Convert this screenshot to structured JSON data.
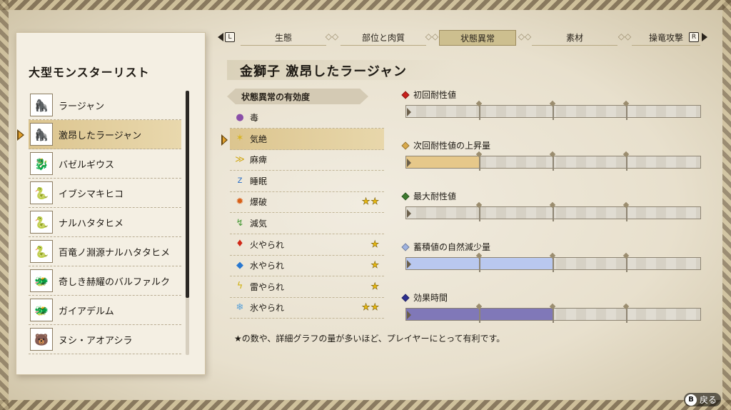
{
  "list_panel": {
    "title": "大型モンスターリスト",
    "items": [
      {
        "label": "ラージャン",
        "icon": "ape-monster-icon",
        "selected": false
      },
      {
        "label": "激昂したラージャン",
        "icon": "ape-monster-icon",
        "selected": true
      },
      {
        "label": "バゼルギウス",
        "icon": "wyvern-monster-icon",
        "selected": false
      },
      {
        "label": "イブシマキヒコ",
        "icon": "serpent-monster-icon",
        "selected": false
      },
      {
        "label": "ナルハタタヒメ",
        "icon": "serpent-monster-icon",
        "selected": false
      },
      {
        "label": "百竜ノ淵源ナルハタタヒメ",
        "icon": "serpent-monster-icon",
        "selected": false
      },
      {
        "label": "奇しき赫耀のバルファルク",
        "icon": "elder-dragon-icon",
        "selected": false
      },
      {
        "label": "ガイアデルム",
        "icon": "elder-dragon-icon",
        "selected": false
      },
      {
        "label": "ヌシ・アオアシラ",
        "icon": "bear-monster-icon",
        "selected": false
      }
    ]
  },
  "tabs": {
    "left_key": "L",
    "right_key": "R",
    "items": [
      {
        "label": "生態",
        "active": false
      },
      {
        "label": "部位と肉質",
        "active": false
      },
      {
        "label": "状態異常",
        "active": true
      },
      {
        "label": "素材",
        "active": false
      },
      {
        "label": "操竜攻撃",
        "active": false
      }
    ]
  },
  "monster_title": "金獅子 激昂したラージャン",
  "status_section": {
    "header": "状態異常の有効度",
    "rows": [
      {
        "label": "毒",
        "icon": "poison-icon",
        "stars": "",
        "star_count": 0,
        "selected": false
      },
      {
        "label": "気絶",
        "icon": "stun-icon",
        "stars": "",
        "star_count": 0,
        "selected": true
      },
      {
        "label": "麻痺",
        "icon": "paralysis-icon",
        "stars": "",
        "star_count": 0,
        "selected": false
      },
      {
        "label": "睡眠",
        "icon": "sleep-icon",
        "stars": "",
        "star_count": 0,
        "selected": false
      },
      {
        "label": "爆破",
        "icon": "blast-icon",
        "stars": "★★",
        "star_count": 2,
        "selected": false
      },
      {
        "label": "減気",
        "icon": "exhaust-icon",
        "stars": "",
        "star_count": 0,
        "selected": false
      },
      {
        "label": "火やられ",
        "icon": "fireblight-icon",
        "stars": "★",
        "star_count": 1,
        "selected": false
      },
      {
        "label": "水やられ",
        "icon": "waterblight-icon",
        "stars": "★",
        "star_count": 1,
        "selected": false
      },
      {
        "label": "雷やられ",
        "icon": "thunderblight-icon",
        "stars": "★",
        "star_count": 1,
        "selected": false
      },
      {
        "label": "氷やられ",
        "icon": "iceblight-icon",
        "stars": "★★",
        "star_count": 2,
        "selected": false
      }
    ]
  },
  "graphs": [
    {
      "label": "初回耐性値",
      "diamond_color": "#c8201c",
      "fill_color": "",
      "fill_fraction": 0.0
    },
    {
      "label": "次回耐性値の上昇量",
      "diamond_color": "#d9a94a",
      "fill_color": "#e6c88a",
      "fill_fraction": 0.25
    },
    {
      "label": "最大耐性値",
      "diamond_color": "#3d7a2e",
      "fill_color": "",
      "fill_fraction": 0.0
    },
    {
      "label": "蓄積値の自然減少量",
      "diamond_color": "#9fb3e0",
      "fill_color": "#b9c8ef",
      "fill_fraction": 0.5
    },
    {
      "label": "効果時間",
      "diamond_color": "#2c2f8f",
      "fill_color": "#8078b8",
      "fill_fraction": 0.5
    }
  ],
  "footnote": "★の数や、詳細グラフの量が多いほど、プレイヤーにとって有利です。",
  "back_hint": {
    "button": "B",
    "label": "戻る"
  }
}
